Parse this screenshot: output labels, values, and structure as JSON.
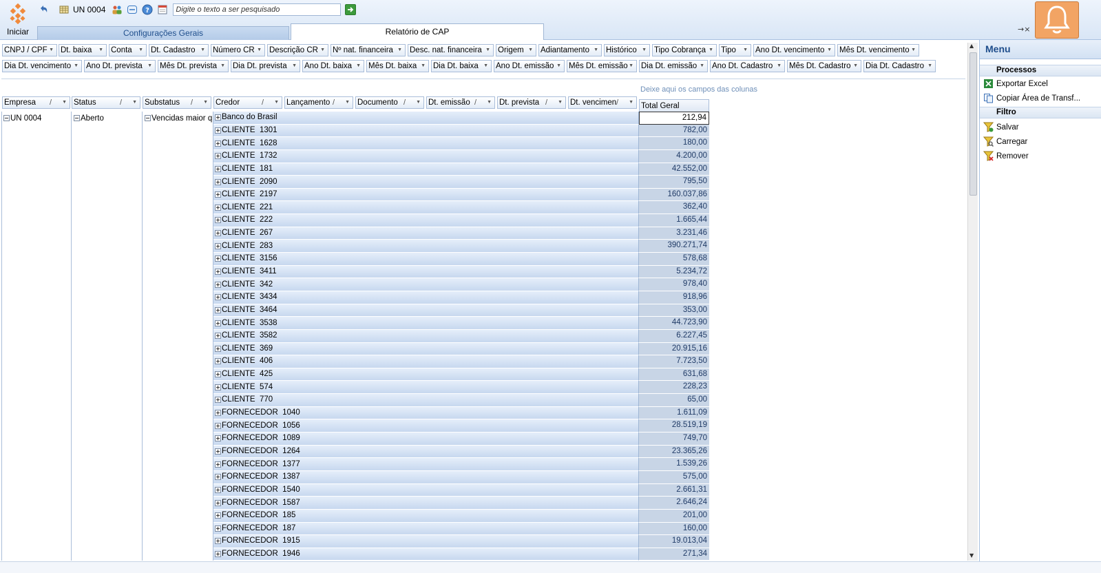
{
  "start": {
    "label": "Iniciar"
  },
  "toolbar": {
    "unit_label": "UN 0004",
    "search_placeholder": "Digite o texto a ser pesquisado"
  },
  "tabs": [
    {
      "label": "Configurações Gerais",
      "active": false
    },
    {
      "label": "Relatório de CAP",
      "active": true
    }
  ],
  "pin_close": "→×",
  "filter_fields_row1": [
    "CNPJ / CPF",
    "Dt. baixa",
    "Conta",
    "Dt. Cadastro",
    "Número CR",
    "Descrição CR",
    "Nº nat. financeira",
    "Desc. nat. financeira",
    "Origem",
    "Adiantamento",
    "Histórico",
    "Tipo Cobrança",
    "Tipo",
    "Ano Dt. vencimento",
    "Mês Dt. vencimento"
  ],
  "filter_fields_row2": [
    "Dia Dt. vencimento",
    "Ano Dt. prevista",
    "Mês Dt. prevista",
    "Dia Dt. prevista",
    "Ano Dt. baixa",
    "Mês Dt. baixa",
    "Dia Dt. baixa",
    "Ano Dt. emissão",
    "Mês Dt. emissão",
    "Dia Dt. emissão",
    "Ano Dt. Cadastro",
    "Mês Dt. Cadastro",
    "Dia Dt. Cadastro"
  ],
  "drop_hint": "Deixe aqui os campos das colunas",
  "row_fields": [
    "Empresa",
    "Status",
    "Substatus",
    "Credor",
    "Lançamento",
    "Documento",
    "Dt. emissão",
    "Dt. prevista",
    "Dt. vencimen"
  ],
  "total_header": "Total Geral",
  "groups": {
    "empresa": "UN 0004",
    "status": "Aberto",
    "substatus": "Vencidas maior qu"
  },
  "rows": [
    {
      "credor": "Banco do Brasil",
      "total": "212,94"
    },
    {
      "credor": "CLIENTE  1301",
      "total": "782,00"
    },
    {
      "credor": "CLIENTE  1628",
      "total": "180,00"
    },
    {
      "credor": "CLIENTE  1732",
      "total": "4.200,00"
    },
    {
      "credor": "CLIENTE  181",
      "total": "42.552,00"
    },
    {
      "credor": "CLIENTE  2090",
      "total": "795,50"
    },
    {
      "credor": "CLIENTE  2197",
      "total": "160.037,86"
    },
    {
      "credor": "CLIENTE  221",
      "total": "362,40"
    },
    {
      "credor": "CLIENTE  222",
      "total": "1.665,44"
    },
    {
      "credor": "CLIENTE  267",
      "total": "3.231,46"
    },
    {
      "credor": "CLIENTE  283",
      "total": "390.271,74"
    },
    {
      "credor": "CLIENTE  3156",
      "total": "578,68"
    },
    {
      "credor": "CLIENTE  3411",
      "total": "5.234,72"
    },
    {
      "credor": "CLIENTE  342",
      "total": "978,40"
    },
    {
      "credor": "CLIENTE  3434",
      "total": "918,96"
    },
    {
      "credor": "CLIENTE  3464",
      "total": "353,00"
    },
    {
      "credor": "CLIENTE  3538",
      "total": "44.723,90"
    },
    {
      "credor": "CLIENTE  3582",
      "total": "6.227,45"
    },
    {
      "credor": "CLIENTE  369",
      "total": "20.915,16"
    },
    {
      "credor": "CLIENTE  406",
      "total": "7.723,50"
    },
    {
      "credor": "CLIENTE  425",
      "total": "631,68"
    },
    {
      "credor": "CLIENTE  574",
      "total": "228,23"
    },
    {
      "credor": "CLIENTE  770",
      "total": "65,00"
    },
    {
      "credor": "FORNECEDOR  1040",
      "total": "1.611,09"
    },
    {
      "credor": "FORNECEDOR  1056",
      "total": "28.519,19"
    },
    {
      "credor": "FORNECEDOR  1089",
      "total": "749,70"
    },
    {
      "credor": "FORNECEDOR  1264",
      "total": "23.365,26"
    },
    {
      "credor": "FORNECEDOR  1377",
      "total": "1.539,26"
    },
    {
      "credor": "FORNECEDOR  1387",
      "total": "575,00"
    },
    {
      "credor": "FORNECEDOR  1540",
      "total": "2.661,31"
    },
    {
      "credor": "FORNECEDOR  1587",
      "total": "2.646,24"
    },
    {
      "credor": "FORNECEDOR  185",
      "total": "201,00"
    },
    {
      "credor": "FORNECEDOR  187",
      "total": "160,00"
    },
    {
      "credor": "FORNECEDOR  1915",
      "total": "19.013,04"
    },
    {
      "credor": "FORNECEDOR  1946",
      "total": "271,34"
    }
  ],
  "menu": {
    "title": "Menu",
    "sections": [
      {
        "title": "Processos",
        "items": [
          "Exportar Excel",
          "Copiar Área de Transf..."
        ]
      },
      {
        "title": "Filtro",
        "items": [
          "Salvar",
          "Carregar",
          "Remover"
        ]
      }
    ]
  },
  "colors": {
    "accent": "#1f4e8c",
    "row_band": "#c7d8ef",
    "bell": "#f2a464"
  }
}
